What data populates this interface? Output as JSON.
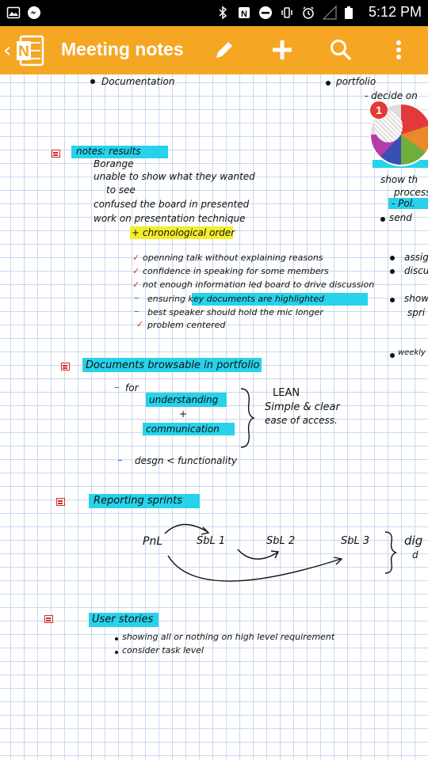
{
  "status_bar": {
    "time": "5:12 PM"
  },
  "app_bar": {
    "title": "Meeting notes",
    "back_glyph": "‹"
  },
  "notification_badge": "1",
  "notes": {
    "top_left": "Documentation",
    "top_right": "portfolio",
    "right_col": [
      "- decide on",
      "show th",
      "process",
      "- Pol.",
      "send",
      "assig",
      "discu",
      "show",
      "spri",
      "weekly"
    ],
    "results": {
      "heading": "notes: results",
      "items": [
        "Borange",
        "unable to show what they wanted",
        "to see",
        "confused the board in presented",
        "work on presentation technique",
        "+ chronological order"
      ],
      "checks": [
        "openning talk without explaining reasons",
        "confidence in speaking for some members",
        "not enough information led board to drive discussion",
        "ensuring key documents are highlighted",
        "best speaker should hold the mic longer",
        "problem centered"
      ]
    },
    "documents": {
      "heading": "Documents browsable in portfolio",
      "for": "for",
      "understanding": "understanding",
      "plus": "+",
      "communication": "communication",
      "lean": "LEAN",
      "simple": "Simple & clear",
      "ease": "ease of access.",
      "design": "desgn < functionality"
    },
    "sprints": {
      "heading": "Reporting sprints",
      "pnl": "PnL",
      "sbl1": "SbL 1",
      "sbl2": "SbL 2",
      "sbl3": "SbL 3",
      "dig": "dig",
      "dig2": "d"
    },
    "user_stories": {
      "heading": "User stories",
      "items": [
        "showing all or nothing on high level requirement",
        "consider task level"
      ]
    }
  }
}
